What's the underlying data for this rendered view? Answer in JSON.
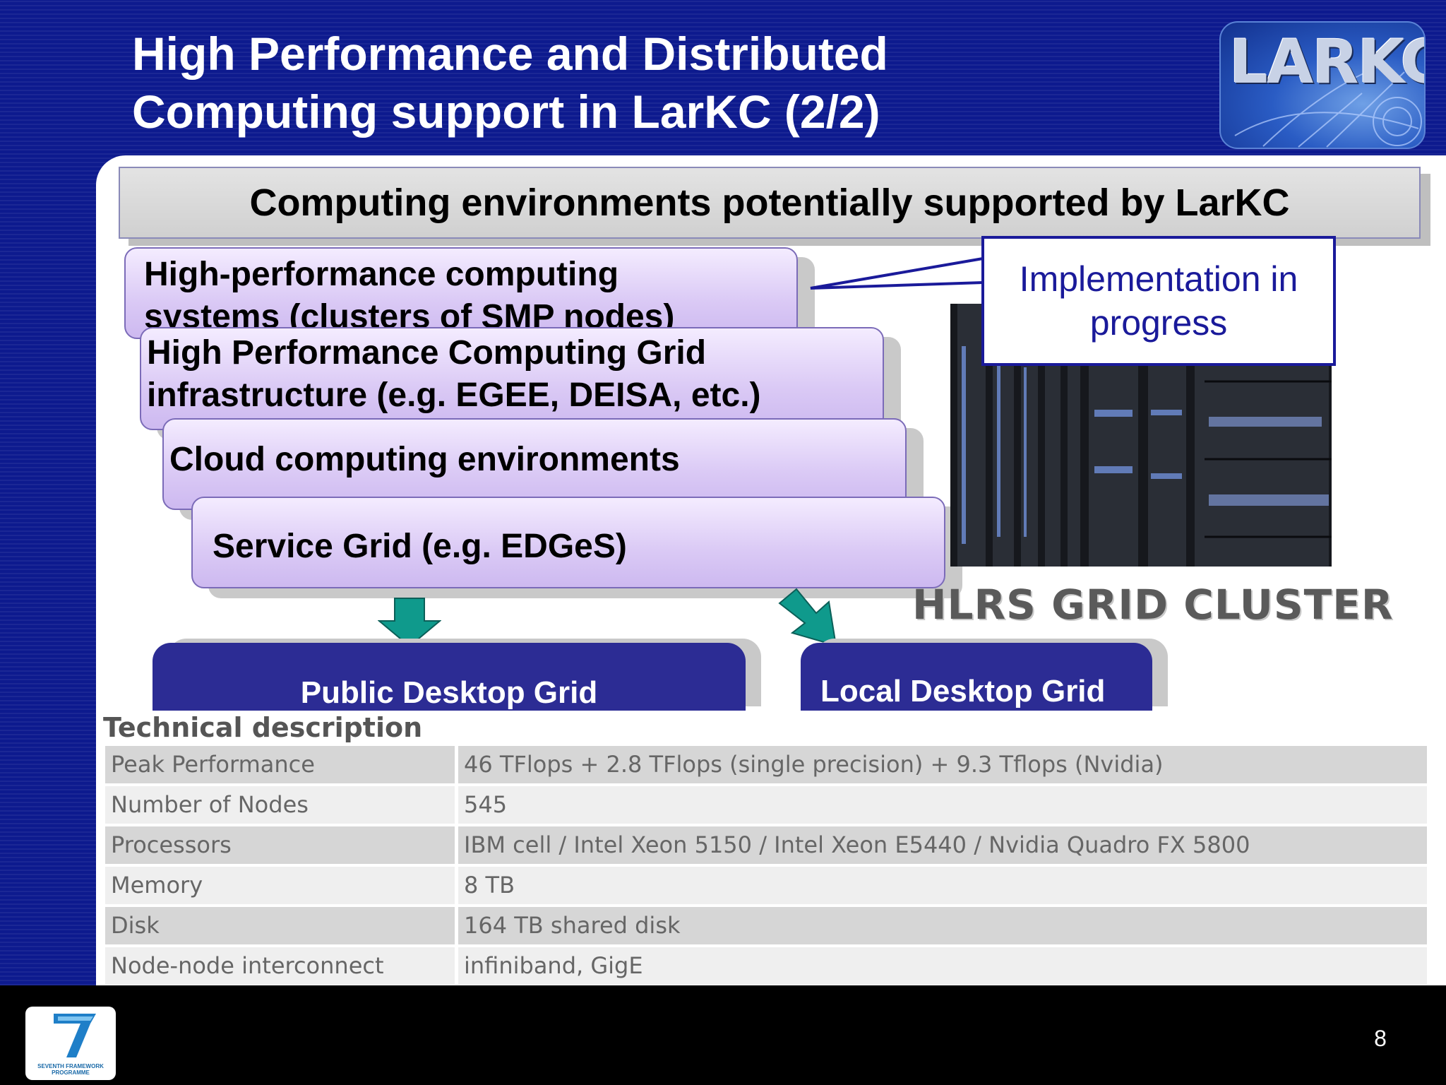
{
  "slide": {
    "title_line1": "High Performance and Distributed",
    "title_line2": "Computing support in LarKC (2/2)",
    "logo_text": "LARKC",
    "header_bar": "Computing environments potentially supported by LarKC",
    "boxes": [
      {
        "line1": "High-performance computing",
        "line2": "systems (clusters of SMP nodes)"
      },
      {
        "line1": "High Performance Computing Grid",
        "line2": "infrastructure (e.g. EGEE, DEISA, etc.)"
      },
      {
        "line1": "Cloud computing environments"
      },
      {
        "line1": "Service Grid  (e.g. EDGeS)"
      }
    ],
    "callout": {
      "line1": "Implementation in",
      "line2": "progress"
    },
    "photo_caption": "HLRS GRID CLUSTER",
    "public_desktop_grid": "Public Desktop Grid",
    "local_desktop_grid": "Local Desktop Grid",
    "page_number": "8",
    "fp7_logo_text": "SEVENTH FRAMEWORK PROGRAMME",
    "colors": {
      "slide_bg": "#0d1a8e",
      "box_purple": "#dac9f5",
      "blue_box": "#2c2c94",
      "arrow_teal": "#0f9a8c",
      "callout_blue": "#1a1a9a"
    }
  },
  "technical_description": {
    "title": "Technical description",
    "rows": [
      {
        "label": "Peak Performance",
        "value": "46 TFlops + 2.8 TFlops (single precision) + 9.3 Tflops (Nvidia)"
      },
      {
        "label": "Number of Nodes",
        "value": "545"
      },
      {
        "label": "Processors",
        "value": "IBM cell / Intel Xeon 5150 / Intel Xeon E5440 / Nvidia Quadro FX 5800"
      },
      {
        "label": "Memory",
        "value": "8 TB"
      },
      {
        "label": "Disk",
        "value": "164 TB shared disk"
      },
      {
        "label": "Node-node interconnect",
        "value": "infiniband, GigE"
      }
    ]
  }
}
